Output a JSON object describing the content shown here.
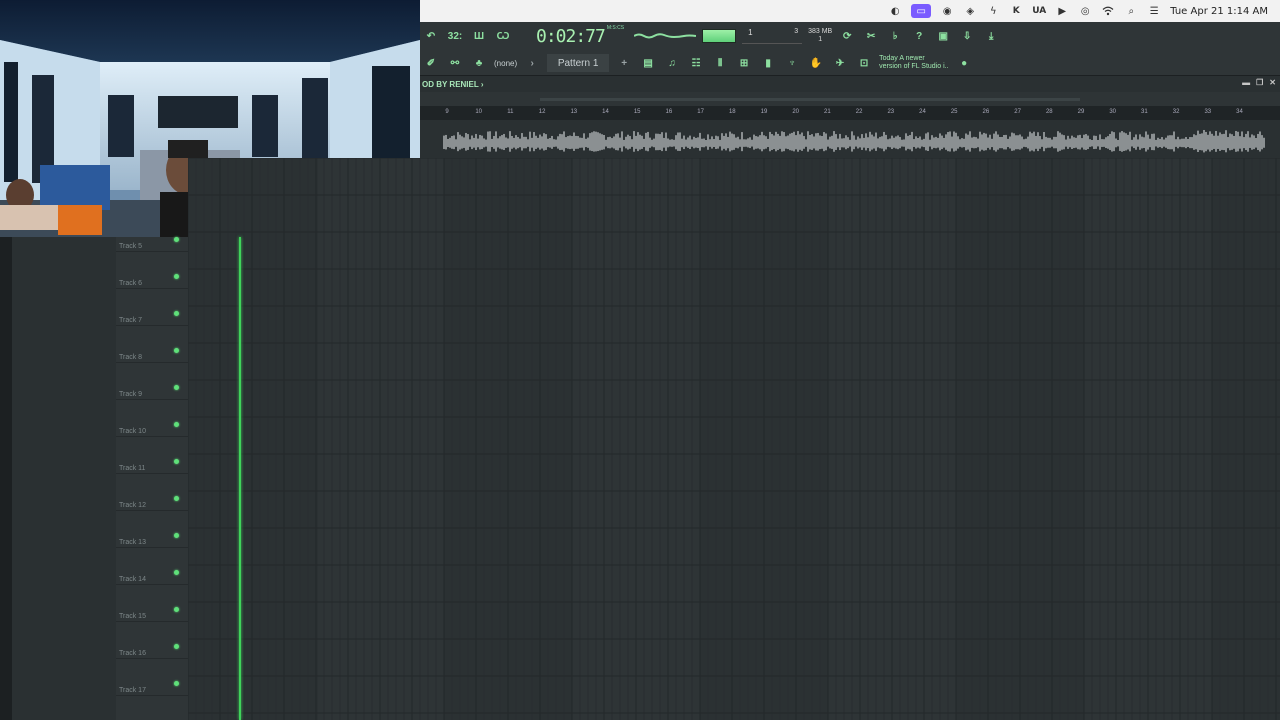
{
  "menubar": {
    "items": [
      {
        "icon": "display-icon"
      },
      {
        "icon": "screen-record-icon",
        "active": true
      },
      {
        "icon": "universal-audio-icon"
      },
      {
        "icon": "eye-icon"
      },
      {
        "icon": "bolt-icon"
      },
      {
        "icon": "k-app-icon"
      },
      {
        "icon": "ua-text-icon",
        "label": "UA"
      },
      {
        "icon": "play-circle-icon"
      },
      {
        "icon": "target-icon"
      },
      {
        "icon": "wifi-icon"
      },
      {
        "icon": "search-icon"
      },
      {
        "icon": "control-center-icon"
      }
    ],
    "clock": "Tue Apr 21  1:14 AM"
  },
  "toolbar": {
    "time": "0:02:77",
    "time_unit": "M:S:CS",
    "beat_counter": "1",
    "beat_counter_right": "3",
    "memory": "383 MB",
    "memory_sub": "1",
    "pattern": "Pattern 1",
    "snap": "(none)",
    "hint_title": "Today",
    "hint_text": "A newer version of FL Studio i..",
    "tempo_label": "32:"
  },
  "playlist": {
    "title": "OD BY RENIEL ›",
    "ruler_ticks": [
      "9",
      "10",
      "11",
      "12",
      "13",
      "14",
      "15",
      "16",
      "17",
      "18",
      "19",
      "20",
      "21",
      "22",
      "23",
      "24",
      "25",
      "26",
      "27",
      "28",
      "29",
      "30",
      "31",
      "32",
      "33",
      "34"
    ],
    "tracks": [
      {
        "label": "Track 5"
      },
      {
        "label": "Track 6"
      },
      {
        "label": "Track 7"
      },
      {
        "label": "Track 8"
      },
      {
        "label": "Track 9"
      },
      {
        "label": "Track 10"
      },
      {
        "label": "Track 11"
      },
      {
        "label": "Track 12"
      },
      {
        "label": "Track 13"
      },
      {
        "label": "Track 14"
      },
      {
        "label": "Track 15"
      },
      {
        "label": "Track 16"
      },
      {
        "label": "Track 17"
      }
    ]
  },
  "colors": {
    "accent": "#3fd35a",
    "led": "#5fe07a",
    "menubar_active": "#7a5cff"
  }
}
